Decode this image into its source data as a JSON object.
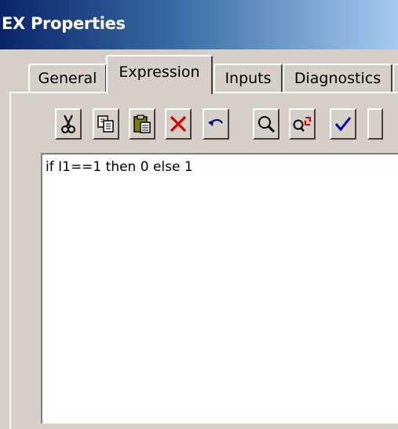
{
  "window": {
    "title": "EX Properties"
  },
  "tabs": [
    {
      "label": "General",
      "active": false
    },
    {
      "label": "Expression",
      "active": true
    },
    {
      "label": "Inputs",
      "active": false
    },
    {
      "label": "Diagnostics",
      "active": false
    }
  ],
  "toolbar": {
    "buttons": [
      {
        "name": "cut",
        "icon": "scissors-icon",
        "glyph": "✂"
      },
      {
        "name": "copy",
        "icon": "copy-icon",
        "glyph": "⎘"
      },
      {
        "name": "paste",
        "icon": "paste-icon",
        "glyph": "📋"
      },
      {
        "name": "delete",
        "icon": "red-x-icon",
        "glyph": "✕"
      },
      {
        "name": "undo",
        "icon": "undo-icon",
        "glyph": "↶"
      },
      {
        "name": "find",
        "icon": "magnifier-icon",
        "glyph": "🔍"
      },
      {
        "name": "replace",
        "icon": "find-replace-icon",
        "glyph": "Q"
      },
      {
        "name": "check",
        "icon": "checkmark-icon",
        "glyph": "✓"
      }
    ]
  },
  "editor": {
    "content": "if I1==1 then 0 else 1"
  },
  "colors": {
    "title_gradient_start": "#0a246a",
    "title_gradient_end": "#a6caf0",
    "face": "#d4d0c8",
    "delete_red": "#d40000",
    "check_blue": "#0000a0"
  }
}
